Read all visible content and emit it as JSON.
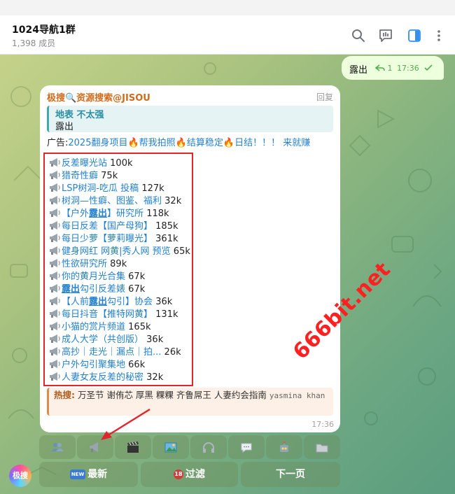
{
  "header": {
    "title": "1024导航1群",
    "subtitle": "1,398 成员",
    "icons": [
      "search-icon",
      "poll-icon",
      "sidebar-toggle-icon",
      "more-vertical-icon"
    ]
  },
  "outgoing_message": {
    "text": "露出",
    "reply_count": "1",
    "time": "17:36",
    "status": "read"
  },
  "bot_message": {
    "sender": "极搜🔍资源搜索@JISOU",
    "reply_label": "回复",
    "quote": {
      "title": "地表 不太强",
      "text": "露出"
    },
    "ad": {
      "prefix": "广告:",
      "p1": "2025翻身项目",
      "p2": "帮我拍照",
      "p3": "结算稳定",
      "p4": "日结！！！ 来就赚"
    },
    "results": [
      {
        "name": "反差曝光站",
        "count": "100k"
      },
      {
        "name": "猎奇性癖",
        "count": "75k"
      },
      {
        "name": "LSP树洞-吃瓜 投稿",
        "count": "127k"
      },
      {
        "name": "树洞—性癖、图鉴、福利",
        "count": "32k"
      },
      {
        "pre": "【户外",
        "hl": "露出",
        "post": "】研究所",
        "count": "118k"
      },
      {
        "name": "每日反差【国产母狗】",
        "count": "185k"
      },
      {
        "name": "每日少萝【萝莉曝光】",
        "count": "361k"
      },
      {
        "name": "健身网红 网黄|秀人网 预览",
        "count": "65k"
      },
      {
        "name": "性欲研究所",
        "count": "89k"
      },
      {
        "name": "你的黄月光合集",
        "count": "67k"
      },
      {
        "pre": "",
        "hl": "露出",
        "post": "勾引反差婊",
        "count": "67k"
      },
      {
        "pre": "【人前",
        "hl": "露出",
        "post": "勾引】协会",
        "count": "36k"
      },
      {
        "name": "每日抖音【推特网黄】",
        "count": "131k"
      },
      {
        "name": "小猫的赏片频道",
        "count": "165k"
      },
      {
        "name": "成人大学（共创版）",
        "count": "36k"
      },
      {
        "name": "高抄｜走光｜漏点｜拍...",
        "count": "26k"
      },
      {
        "name": "户外勾引聚集地",
        "count": "66k"
      },
      {
        "name": "人妻女友反差的秘密",
        "count": "32k"
      }
    ],
    "hot": {
      "label": "热搜:",
      "terms": "万圣节 谢侑芯 厚黑 粿粿 齐鲁屌王 人妻约会指南",
      "mono": "yasmina khan"
    },
    "time": "17:36"
  },
  "keyboard": {
    "row1_icons": [
      "users-icon",
      "megaphone-icon",
      "clapper-icon",
      "image-icon",
      "headphones-icon",
      "speech-bubble-icon",
      "robot-icon",
      "folder-icon"
    ],
    "row2": {
      "new_label": "最新",
      "new_badge": "NEW",
      "filter_label": "过滤",
      "filter_badge": "18",
      "next_label": "下一页"
    }
  },
  "watermark": "666bit.net",
  "avatar_text": "极搜",
  "colors": {
    "accent_link": "#2481cc",
    "sender": "#d16b1c",
    "highlight_box": "#e0262b",
    "outgoing_bubble": "#eeffde",
    "watermark": "#ff2121"
  }
}
